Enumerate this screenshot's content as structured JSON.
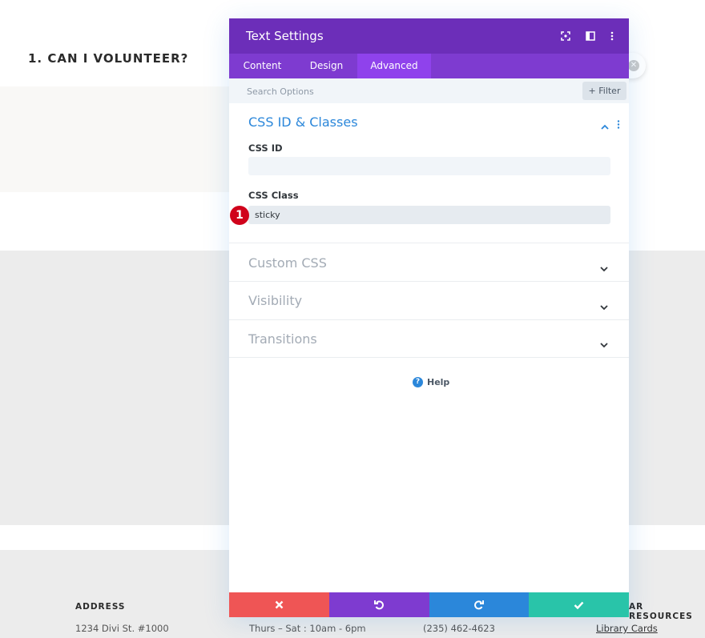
{
  "background": {
    "heading": "1. CAN I VOLUNTEER?",
    "footer": {
      "address_heading": "ADDRESS",
      "address_value": "1234 Divi St. #1000",
      "hours_value": "Thurs – Sat : 10am - 6pm",
      "phone_value": "(235) 462-4623",
      "resources_heading": "AR RESOURCES",
      "resources_link": "Library Cards"
    }
  },
  "modal": {
    "title": "Text Settings",
    "header_icons": [
      "focus-icon",
      "split-view-icon",
      "more-icon"
    ],
    "tabs": [
      {
        "label": "Content",
        "active": false
      },
      {
        "label": "Design",
        "active": false
      },
      {
        "label": "Advanced",
        "active": true
      }
    ],
    "search": {
      "placeholder": "Search Options"
    },
    "filter_label": "Filter",
    "section": {
      "title": "CSS ID & Classes",
      "fields": [
        {
          "label": "CSS ID",
          "value": ""
        },
        {
          "label": "CSS Class",
          "value": "sticky"
        }
      ]
    },
    "step_badge": "1",
    "collapsed": [
      "Custom CSS",
      "Visibility",
      "Transitions"
    ],
    "help_label": "Help",
    "footer_colors": {
      "cancel": "#ef5555",
      "undo": "#7e3bd0",
      "redo": "#2b87da",
      "save": "#29c4a9"
    }
  },
  "colors": {
    "header": "#6c2eb9",
    "tabs": "#7e3bd0",
    "accent": "#2b87da",
    "badge": "#d0021b"
  }
}
